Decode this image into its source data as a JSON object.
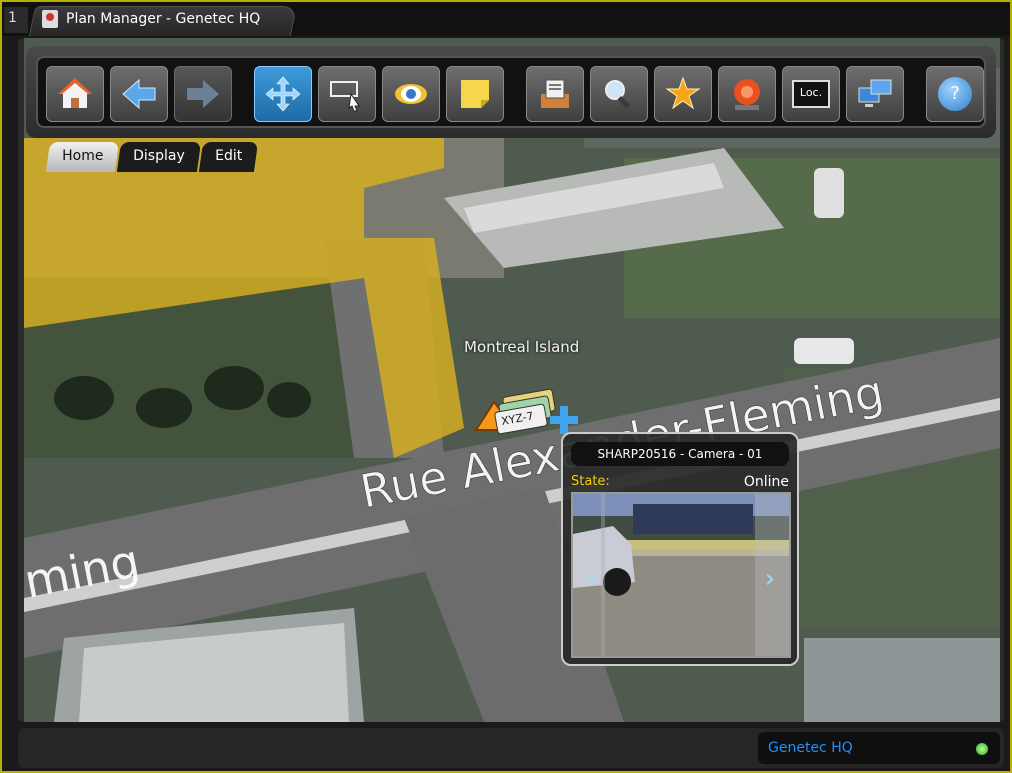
{
  "window": {
    "tab_number": "1",
    "tab_title": "Plan Manager - Genetec HQ"
  },
  "toolbar": {
    "buttons": [
      {
        "name": "home",
        "icon": "home-icon"
      },
      {
        "name": "back",
        "icon": "arrow-left-icon"
      },
      {
        "name": "forward",
        "icon": "arrow-right-icon"
      },
      {
        "name": "pan",
        "icon": "move-icon",
        "active": true
      },
      {
        "name": "select",
        "icon": "select-area-icon"
      },
      {
        "name": "view",
        "icon": "eye-icon"
      },
      {
        "name": "note",
        "icon": "sticky-note-icon"
      },
      {
        "name": "inbox",
        "icon": "inbox-icon"
      },
      {
        "name": "search",
        "icon": "search-icon"
      },
      {
        "name": "favorites",
        "icon": "star-icon"
      },
      {
        "name": "alarm",
        "icon": "alarm-icon"
      },
      {
        "name": "location",
        "icon": "loc-monitor-icon",
        "label": "Loc."
      },
      {
        "name": "network",
        "icon": "network-icon"
      },
      {
        "name": "help",
        "icon": "help-icon",
        "label": "?"
      }
    ]
  },
  "subtabs": [
    {
      "label": "Home",
      "active": true
    },
    {
      "label": "Display",
      "active": false
    },
    {
      "label": "Edit",
      "active": false
    }
  ],
  "map": {
    "area_label": "Montreal Island",
    "street_label_main": "Rue Alexander-Fleming",
    "street_label_left": "ming",
    "plate_text": "XYZ-7"
  },
  "camera_popup": {
    "title": "SHARP20516 - Camera - 01",
    "state_label": "State:",
    "state_value": "Online"
  },
  "status_bar": {
    "site_name": "Genetec HQ",
    "status_color": "#2fa82f"
  },
  "colors": {
    "frame_accent": "#b8b000",
    "active_tool": "#2f86c8",
    "zone_overlay": "#d8b020",
    "state_label": "#f0d000",
    "site_text": "#1e90ff"
  }
}
